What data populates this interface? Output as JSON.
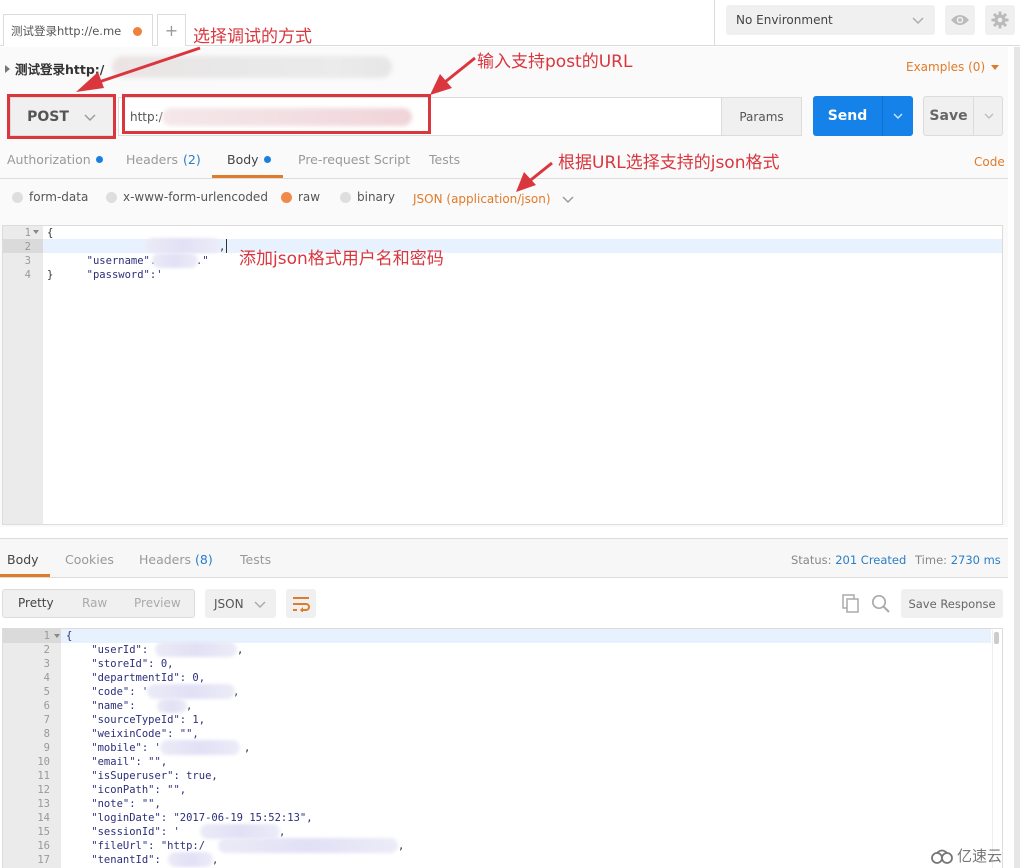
{
  "tabs": {
    "active_tab_title": "测试登录http://e.me",
    "add_tab": "+"
  },
  "environment": {
    "selected": "No Environment",
    "icons": [
      "eye-icon",
      "gear-icon"
    ]
  },
  "request": {
    "name": "测试登录http:/",
    "examples_label": "Examples (0)",
    "method": "POST",
    "url": "http:/",
    "params_label": "Params",
    "send_label": "Send",
    "save_label": "Save",
    "code_label": "Code",
    "tabs": [
      {
        "label": "Authorization",
        "dot": true
      },
      {
        "label": "Headers",
        "count": "(2)"
      },
      {
        "label": "Body",
        "dot": true,
        "active": true
      },
      {
        "label": "Pre-request Script"
      },
      {
        "label": "Tests"
      }
    ],
    "body_types": [
      {
        "label": "form-data",
        "selected": false
      },
      {
        "label": "x-www-form-urlencoded",
        "selected": false
      },
      {
        "label": "raw",
        "selected": true
      },
      {
        "label": "binary",
        "selected": false
      }
    ],
    "raw_format": "JSON (application/json)",
    "body_lines": [
      {
        "n": "1",
        "text": "{"
      },
      {
        "n": "2",
        "key": "\"username\"",
        "sep": ".",
        "tail": ","
      },
      {
        "n": "3",
        "key": "\"password\"",
        "sep": ":'",
        "tail": ".\""
      },
      {
        "n": "4",
        "text": "}"
      }
    ]
  },
  "annotations": {
    "method": "选择调试的方式",
    "url": "输入支持post的URL",
    "format": "根据URL选择支持的json格式",
    "body": "添加json格式用户名和密码"
  },
  "response": {
    "tabs": [
      {
        "label": "Body",
        "active": true
      },
      {
        "label": "Cookies"
      },
      {
        "label": "Headers",
        "count": "(8)"
      },
      {
        "label": "Tests"
      }
    ],
    "status_label": "Status:",
    "status_value": "201 Created",
    "time_label": "Time:",
    "time_value": "2730 ms",
    "view_modes": [
      "Pretty",
      "Raw",
      "Preview"
    ],
    "active_view": "Pretty",
    "format": "JSON",
    "save_response_label": "Save Response",
    "lines": [
      {
        "n": "1",
        "text": "{"
      },
      {
        "n": "2",
        "text": "    \"userId\": ",
        "tail": ","
      },
      {
        "n": "3",
        "text": "    \"storeId\": 0,"
      },
      {
        "n": "4",
        "text": "    \"departmentId\": 0,"
      },
      {
        "n": "5",
        "text": "    \"code\": '",
        "tail": ","
      },
      {
        "n": "6",
        "text": "    \"name\": ",
        "tail": ","
      },
      {
        "n": "7",
        "text": "    \"sourceTypeId\": 1,"
      },
      {
        "n": "8",
        "text": "    \"weixinCode\": \"\","
      },
      {
        "n": "9",
        "text": "    \"mobile\": '",
        "tail": ","
      },
      {
        "n": "10",
        "text": "    \"email\": \"\","
      },
      {
        "n": "11",
        "text": "    \"isSuperuser\": true,"
      },
      {
        "n": "12",
        "text": "    \"iconPath\": \"\","
      },
      {
        "n": "13",
        "text": "    \"note\": \"\","
      },
      {
        "n": "14",
        "text": "    \"loginDate\": \"2017-06-19 15:52:13\","
      },
      {
        "n": "15",
        "text": "    \"sessionId\": '",
        "tail": ","
      },
      {
        "n": "16",
        "text": "    \"fileUrl\": \"http:/",
        "tail": ","
      },
      {
        "n": "17",
        "text": "    \"tenantId\": ",
        "tail": ","
      }
    ]
  },
  "watermark": "亿速云",
  "colors": {
    "accent_orange": "#e07b2a",
    "send_blue": "#1482e8",
    "annotation_red": "#d9363e",
    "link_blue": "#2b7dc6"
  }
}
